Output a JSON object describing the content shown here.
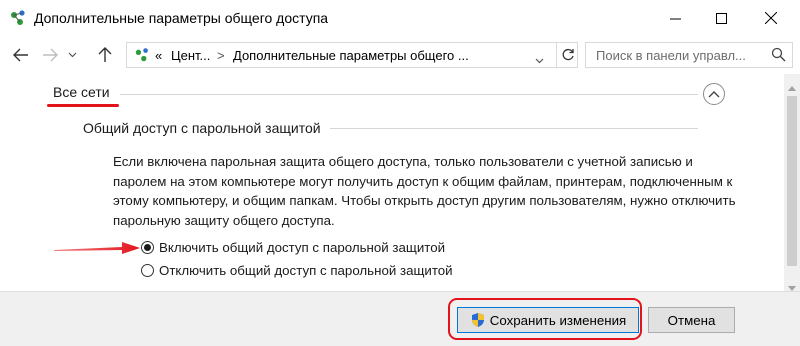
{
  "window": {
    "title": "Дополнительные параметры общего доступа",
    "icon": "network-sharing-icon"
  },
  "nav": {
    "address": {
      "overflow": "«",
      "segment1": "Цент...",
      "separator": ">",
      "segment2": "Дополнительные параметры общего ..."
    },
    "search": {
      "placeholder": "Поиск в панели управл..."
    }
  },
  "content": {
    "section_title": "Все сети",
    "subsection_title": "Общий доступ с парольной защитой",
    "description": "Если включена парольная защита общего доступа, только пользователи с учетной записью и паролем на этом компьютере могут получить доступ к общим файлам, принтерам, подключенным к этому компьютеру, и общим папкам. Чтобы открыть доступ другим пользователям, нужно отключить парольную защиту общего доступа.",
    "options": [
      {
        "label": "Включить общий доступ с парольной защитой",
        "selected": true
      },
      {
        "label": "Отключить общий доступ с парольной защитой",
        "selected": false
      }
    ]
  },
  "footer": {
    "save_label": "Сохранить изменения",
    "cancel_label": "Отмена"
  },
  "colors": {
    "annotation": "#e3131b",
    "accent": "#0078d7"
  }
}
